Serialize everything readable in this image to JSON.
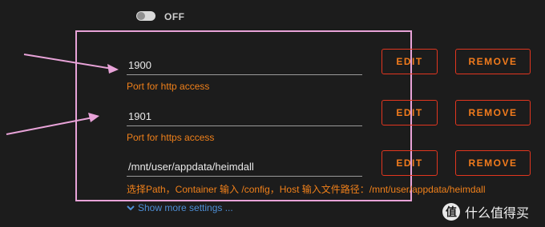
{
  "toggle": {
    "label": "OFF",
    "state": "off"
  },
  "fields": [
    {
      "value": "1900",
      "description": "Port for http access"
    },
    {
      "value": "1901",
      "description": "Port for https access"
    },
    {
      "value": "/mnt/user/appdata/heimdall",
      "description": "选择Path，Container 输入 /config，Host 输入文件路径：/mnt/user/appdata/heimdall"
    }
  ],
  "buttons": {
    "edit_label": "EDIT",
    "remove_label": "REMOVE"
  },
  "show_more_label": "Show more settings ...",
  "watermark": {
    "logo_char": "值",
    "text": "什么值得买"
  },
  "colors": {
    "background": "#1c1c1c",
    "accent_orange": "#f27b1c",
    "button_border": "#e2361f",
    "link_blue": "#4e8fd6",
    "annotation_pink": "#e8a3d8"
  }
}
